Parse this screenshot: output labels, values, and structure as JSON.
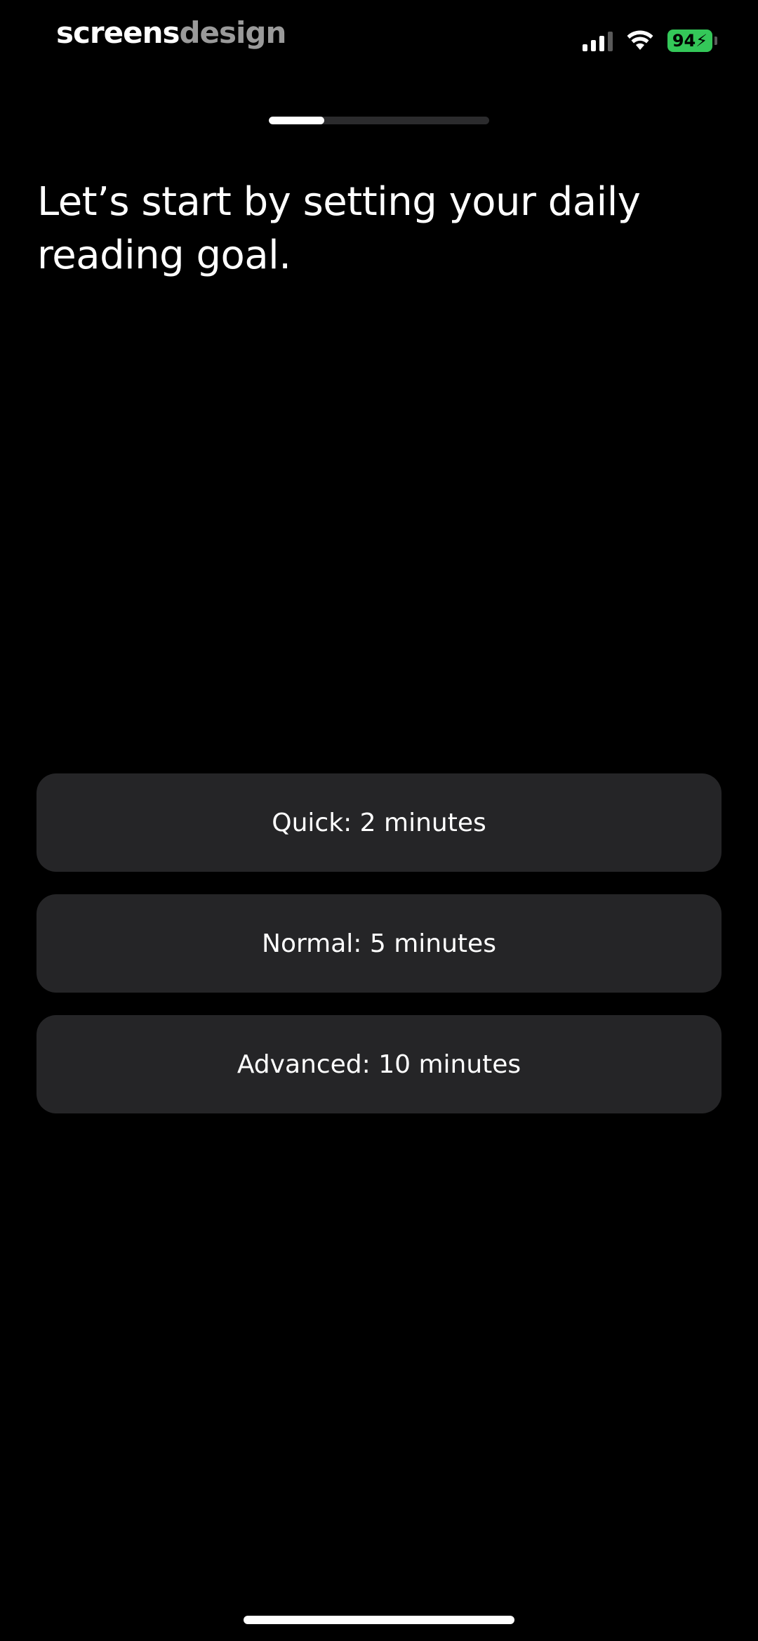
{
  "watermark": {
    "part1": "screens",
    "part2": "design"
  },
  "status_bar": {
    "battery_level": "94",
    "signal_icon": "cellular-signal-icon",
    "wifi_icon": "wifi-icon",
    "battery_icon": "battery-charging-icon",
    "battery_color": "#34c759"
  },
  "progress": {
    "fraction": 0.25
  },
  "title": "Let’s start by setting your daily reading goal.",
  "options": [
    {
      "label": "Quick: 2 minutes"
    },
    {
      "label": "Normal: 5 minutes"
    },
    {
      "label": "Advanced: 10 minutes"
    }
  ],
  "colors": {
    "background": "#000000",
    "option_background": "#252527",
    "text": "#ffffff"
  }
}
